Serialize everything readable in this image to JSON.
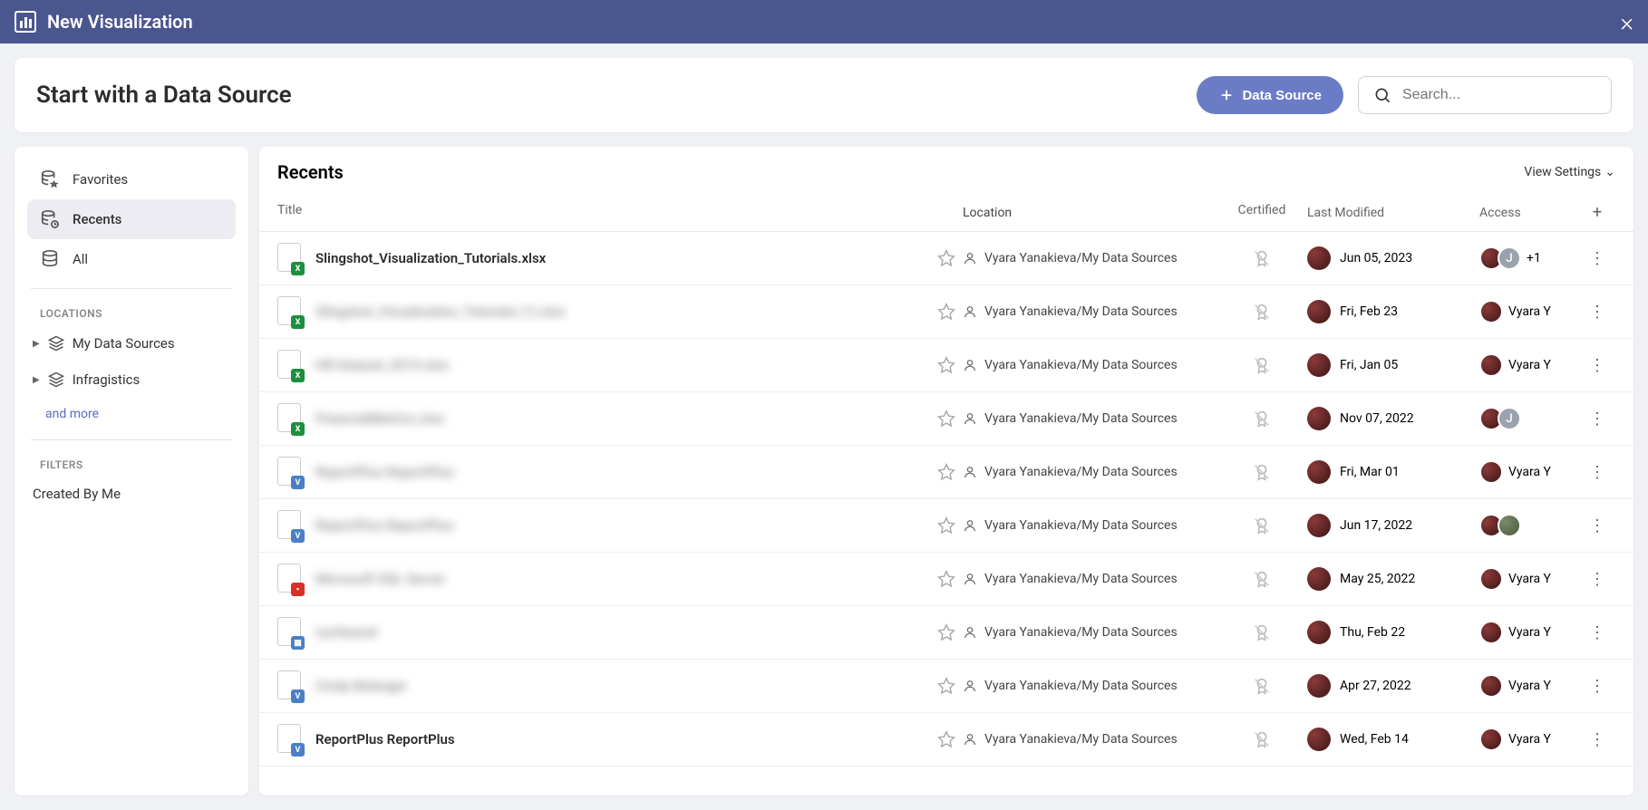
{
  "header": {
    "title": "New Visualization"
  },
  "toolbar": {
    "title": "Start with a Data Source",
    "add_button": "Data Source",
    "search_placeholder": "Search..."
  },
  "sidebar": {
    "items": [
      {
        "label": "Favorites"
      },
      {
        "label": "Recents"
      },
      {
        "label": "All"
      }
    ],
    "locations_heading": "Locations",
    "locations": [
      {
        "label": "My Data Sources"
      },
      {
        "label": "Infragistics"
      }
    ],
    "more_link": "and more",
    "filters_heading": "Filters",
    "filter_created": "Created By Me"
  },
  "main": {
    "title": "Recents",
    "view_settings": "View Settings",
    "columns": {
      "title": "Title",
      "location": "Location",
      "certified": "Certified",
      "modified": "Last Modified",
      "access": "Access"
    },
    "rows": [
      {
        "title": "Slingshot_Visualization_Tutorials.xlsx",
        "blurred": false,
        "icon": "xlsx",
        "location": "Vyara Yanakieva/My Data Sources",
        "modified": "Jun 05, 2023",
        "access_text": "+1",
        "access_avatars": [
          "user",
          "grey"
        ]
      },
      {
        "title": "Slingshot_Visualization_Tutorials (1).xlsx",
        "blurred": true,
        "icon": "xlsx",
        "location": "Vyara Yanakieva/My Data Sources",
        "modified": "Fri, Feb 23",
        "access_text": "Vyara Y",
        "access_avatars": [
          "user"
        ]
      },
      {
        "title": "HR Dataset_2019.xlsx",
        "blurred": true,
        "icon": "xlsx",
        "location": "Vyara Yanakieva/My Data Sources",
        "modified": "Fri, Jan 05",
        "access_text": "Vyara Y",
        "access_avatars": [
          "user"
        ]
      },
      {
        "title": "FinancialMetrics.xlsx",
        "blurred": true,
        "icon": "xlsx",
        "location": "Vyara Yanakieva/My Data Sources",
        "modified": "Nov 07, 2022",
        "access_text": "",
        "access_avatars": [
          "user",
          "grey"
        ]
      },
      {
        "title": "ReportPlus ReportPlus",
        "blurred": true,
        "icon": "v",
        "location": "Vyara Yanakieva/My Data Sources",
        "modified": "Fri, Mar 01",
        "access_text": "Vyara Y",
        "access_avatars": [
          "user"
        ]
      },
      {
        "title": "ReportPlus ReportPlus",
        "blurred": true,
        "icon": "v",
        "location": "Vyara Yanakieva/My Data Sources",
        "modified": "Jun 17, 2022",
        "access_text": "",
        "access_avatars": [
          "user",
          "alt"
        ]
      },
      {
        "title": "Microsoft SQL Server",
        "blurred": true,
        "icon": "pdf",
        "location": "Vyara Yanakieva/My Data Sources",
        "modified": "May 25, 2022",
        "access_text": "Vyara Y",
        "access_avatars": [
          "user"
        ]
      },
      {
        "title": "northwind",
        "blurred": true,
        "icon": "db",
        "location": "Vyara Yanakieva/My Data Sources",
        "modified": "Thu, Feb 22",
        "access_text": "Vyara Y",
        "access_avatars": [
          "user"
        ]
      },
      {
        "title": "Cindy Belanger",
        "blurred": true,
        "icon": "v",
        "location": "Vyara Yanakieva/My Data Sources",
        "modified": "Apr 27, 2022",
        "access_text": "Vyara Y",
        "access_avatars": [
          "user"
        ]
      },
      {
        "title": "ReportPlus ReportPlus",
        "blurred": false,
        "icon": "v",
        "location": "Vyara Yanakieva/My Data Sources",
        "modified": "Wed, Feb 14",
        "access_text": "Vyara Y",
        "access_avatars": [
          "user"
        ]
      }
    ]
  }
}
